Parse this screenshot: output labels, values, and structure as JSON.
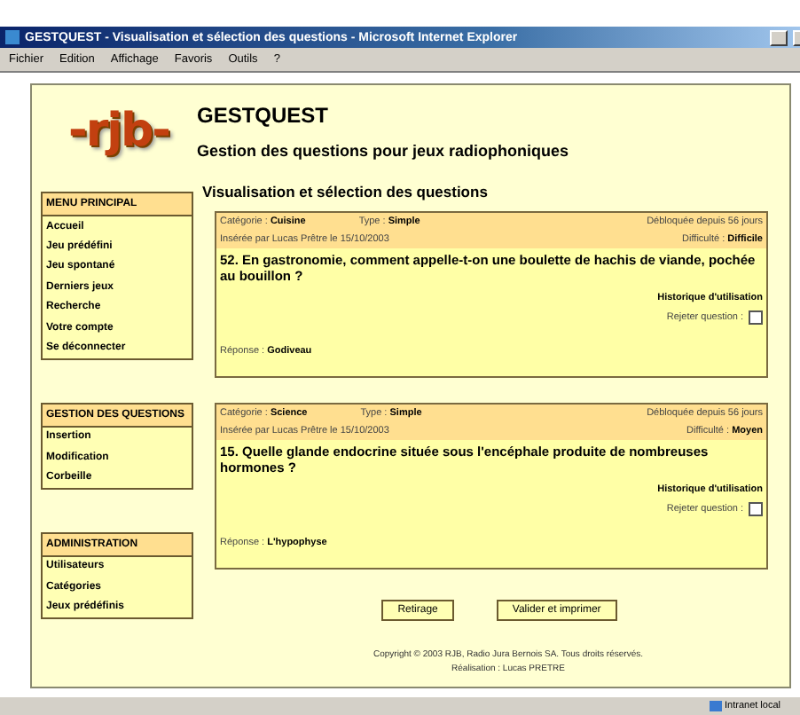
{
  "window": {
    "title": "GESTQUEST - Visualisation et sélection des questions - Microsoft Internet Explorer"
  },
  "menu_bar": [
    "Fichier",
    "Edition",
    "Affichage",
    "Favoris",
    "Outils",
    "?"
  ],
  "header": {
    "logo_text": "-rjb-",
    "title": "GESTQUEST",
    "subtitle": "Gestion des questions pour jeux radiophoniques"
  },
  "sidebar": [
    {
      "title": "MENU PRINCIPAL",
      "items": [
        "Accueil",
        "Jeu prédéfini",
        "Jeu spontané",
        "Derniers jeux",
        "Recherche",
        "Votre compte",
        "Se déconnecter"
      ]
    },
    {
      "title": "GESTION DES QUESTIONS",
      "items": [
        "Insertion",
        "Modification",
        "Corbeille"
      ]
    },
    {
      "title": "ADMINISTRATION",
      "items": [
        "Utilisateurs",
        "Catégories",
        "Jeux prédéfinis"
      ]
    }
  ],
  "page_title": "Visualisation et sélection des questions",
  "questions": [
    {
      "category_label": "Catégorie :",
      "category": "Cuisine",
      "type_label": "Type :",
      "type": "Simple",
      "unlocked": "Débloquée depuis 56 jours",
      "inserted": "Insérée par Lucas Prêtre le 15/10/2003",
      "difficulty_label": "Difficulté :",
      "difficulty": "Difficile",
      "question": "52. En gastronomie, comment appelle-t-on une boulette de hachis de viande, pochée au bouillon ?",
      "history": "Historique d'utilisation",
      "reject_label": "Rejeter question :",
      "reject_checked": false,
      "answer_label": "Réponse :",
      "answer": "Godiveau"
    },
    {
      "category_label": "Catégorie :",
      "category": "Science",
      "type_label": "Type :",
      "type": "Simple",
      "unlocked": "Débloquée depuis 56 jours",
      "inserted": "Insérée par Lucas Prêtre le 15/10/2003",
      "difficulty_label": "Difficulté :",
      "difficulty": "Moyen",
      "question": "15. Quelle glande endocrine située sous l'encéphale produite de nombreuses hormones ?",
      "history": "Historique d'utilisation",
      "reject_label": "Rejeter question :",
      "reject_checked": false,
      "answer_label": "Réponse :",
      "answer": "L'hypophyse"
    }
  ],
  "buttons": [
    "Retirage",
    "Valider et imprimer"
  ],
  "footer": [
    "Copyright © 2003 RJB, Radio Jura Bernois SA. Tous droits réservés.",
    "Réalisation : Lucas PRETRE"
  ],
  "status_bar": {
    "zone": "Intranet local"
  }
}
